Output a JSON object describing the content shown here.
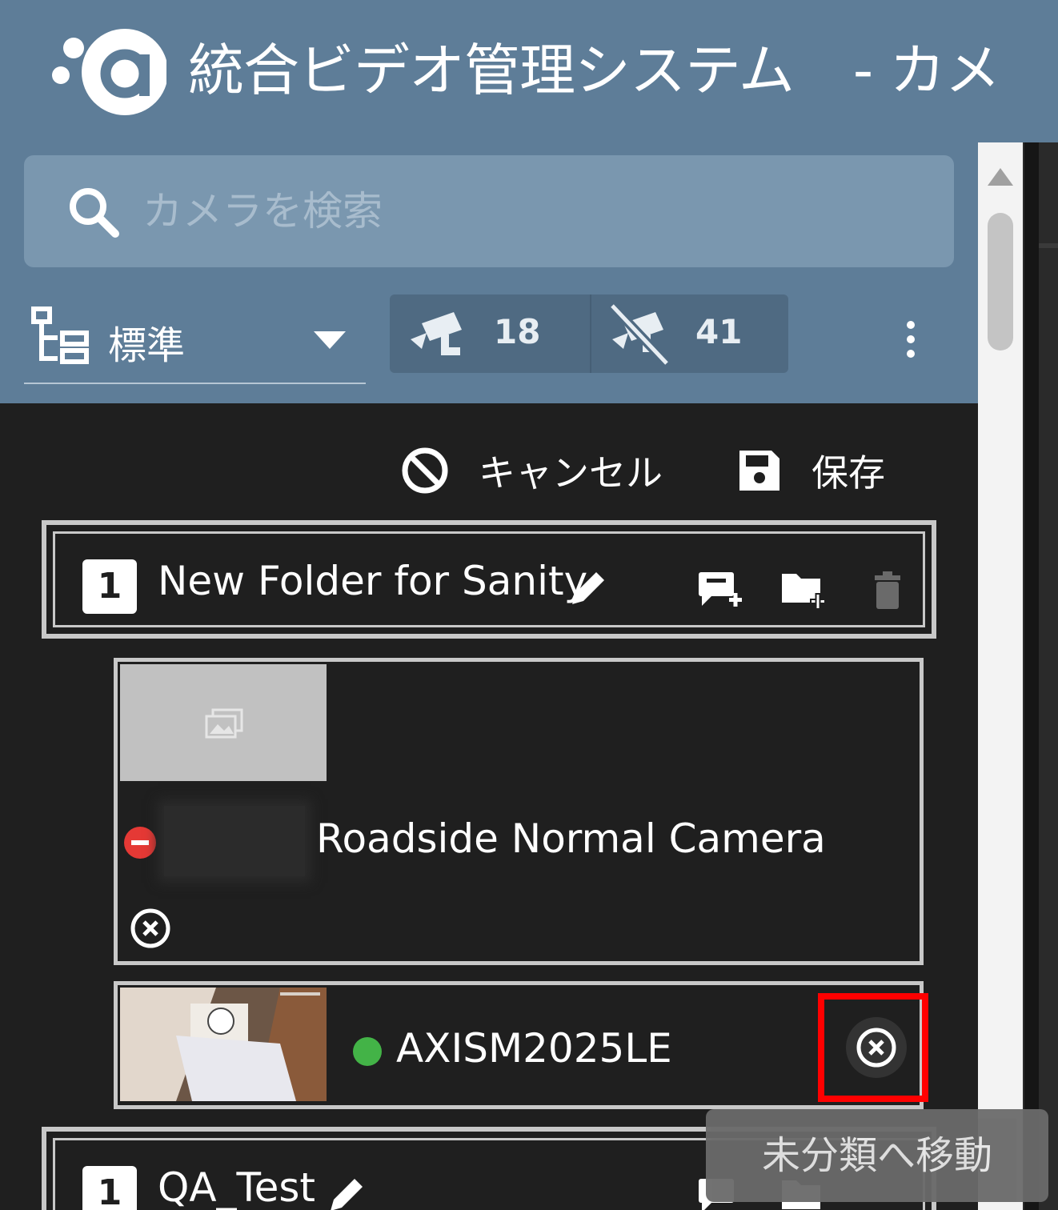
{
  "header": {
    "title": "統合ビデオ管理システム",
    "title_suffix": "- カメ"
  },
  "search": {
    "placeholder": "カメラを検索"
  },
  "layout_select": {
    "value": "標準"
  },
  "camera_stats": {
    "online_count": "18",
    "offline_count": "41"
  },
  "actions": {
    "cancel_label": "キャンセル",
    "save_label": "保存"
  },
  "folders": [
    {
      "badge": "1",
      "name": "New Folder for Sanity",
      "cameras": [
        {
          "name": "Roadside Normal Camera",
          "status": "offline",
          "status_color": "#e53935"
        },
        {
          "name": "AXISM2025LE",
          "status": "online",
          "status_color": "#43b347"
        }
      ]
    },
    {
      "badge": "1",
      "name": "QA_Test"
    }
  ],
  "tooltip": {
    "text": "未分類へ移動"
  },
  "colors": {
    "header_bg": "#5e7d98",
    "list_bg": "#1f1f1f",
    "highlight": "#ff0000"
  },
  "icons": [
    "app-logo",
    "search-icon",
    "layout-tree-icon",
    "chevron-down-icon",
    "camera-online-icon",
    "camera-offline-icon",
    "more-vert-icon",
    "cancel-icon",
    "save-icon",
    "edit-icon",
    "add-camera-icon",
    "add-folder-icon",
    "delete-icon",
    "image-placeholder-icon",
    "remove-circle-icon"
  ]
}
